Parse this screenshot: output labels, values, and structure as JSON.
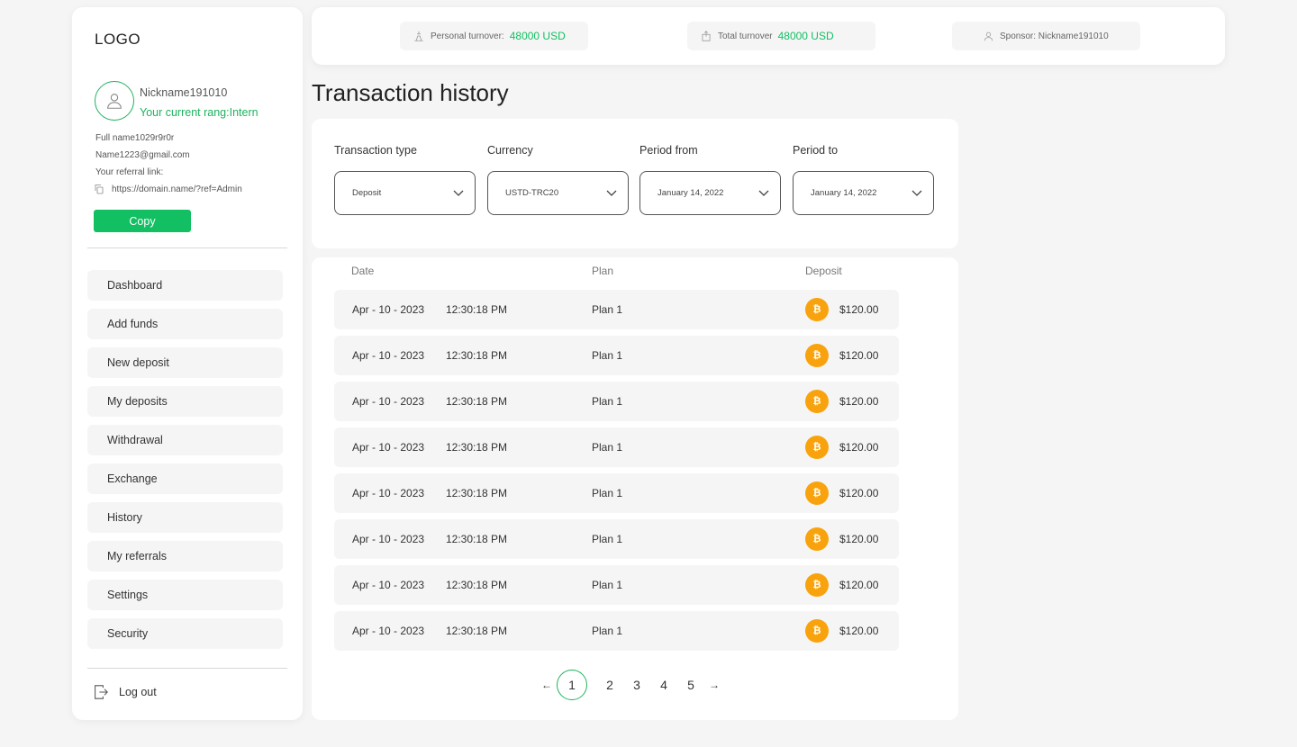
{
  "sidebar": {
    "logo": "LOGO",
    "nickname": "Nickname191010",
    "rang": "Your current rang:Intern",
    "full_name": "Full name1029r9r0r",
    "email": "Name1223@gmail.com",
    "referral_label": "Your referral link:",
    "referral_url": "https://domain.name/?ref=Admin",
    "copy_label": "Copy",
    "nav": [
      "Dashboard",
      "Add funds",
      "New deposit",
      "My deposits",
      "Withdrawal",
      "Exchange",
      "History",
      "My referrals",
      "Settings",
      "Security"
    ],
    "logout": "Log out"
  },
  "topbar": {
    "personal_label": "Personal turnover:",
    "personal_value": "48000 USD",
    "total_label": "Total turnover",
    "total_value": "48000 USD",
    "sponsor": "Sponsor: Nickname191010"
  },
  "page_title": "Transaction history",
  "filters": {
    "type_label": "Transaction type",
    "type_value": "Deposit",
    "currency_label": "Currency",
    "currency_value": "USTD-TRC20",
    "from_label": "Period from",
    "from_value": "January 14, 2022",
    "to_label": "Period to",
    "to_value": "January 14, 2022"
  },
  "table": {
    "headers": {
      "date": "Date",
      "plan": "Plan",
      "deposit": "Deposit"
    },
    "rows": [
      {
        "date": "Apr - 10 - 2023",
        "time": "12:30:18 PM",
        "plan": "Plan 1",
        "coin": "₿",
        "amount": "$120.00"
      },
      {
        "date": "Apr - 10 - 2023",
        "time": "12:30:18 PM",
        "plan": "Plan 1",
        "coin": "₿",
        "amount": "$120.00"
      },
      {
        "date": "Apr - 10 - 2023",
        "time": "12:30:18 PM",
        "plan": "Plan 1",
        "coin": "₿",
        "amount": "$120.00"
      },
      {
        "date": "Apr - 10 - 2023",
        "time": "12:30:18 PM",
        "plan": "Plan 1",
        "coin": "₿",
        "amount": "$120.00"
      },
      {
        "date": "Apr - 10 - 2023",
        "time": "12:30:18 PM",
        "plan": "Plan 1",
        "coin": "₿",
        "amount": "$120.00"
      },
      {
        "date": "Apr - 10 - 2023",
        "time": "12:30:18 PM",
        "plan": "Plan 1",
        "coin": "₿",
        "amount": "$120.00"
      },
      {
        "date": "Apr - 10 - 2023",
        "time": "12:30:18 PM",
        "plan": "Plan 1",
        "coin": "₿",
        "amount": "$120.00"
      },
      {
        "date": "Apr - 10 - 2023",
        "time": "12:30:18 PM",
        "plan": "Plan 1",
        "coin": "₿",
        "amount": "$120.00"
      }
    ]
  },
  "pagination": {
    "prev": "←",
    "pages": [
      "1",
      "2",
      "3",
      "4",
      "5"
    ],
    "current": "1",
    "next": "→"
  },
  "colors": {
    "accent": "#13bf63",
    "coin": "#f8a30e",
    "background": "#f5f5f5"
  }
}
